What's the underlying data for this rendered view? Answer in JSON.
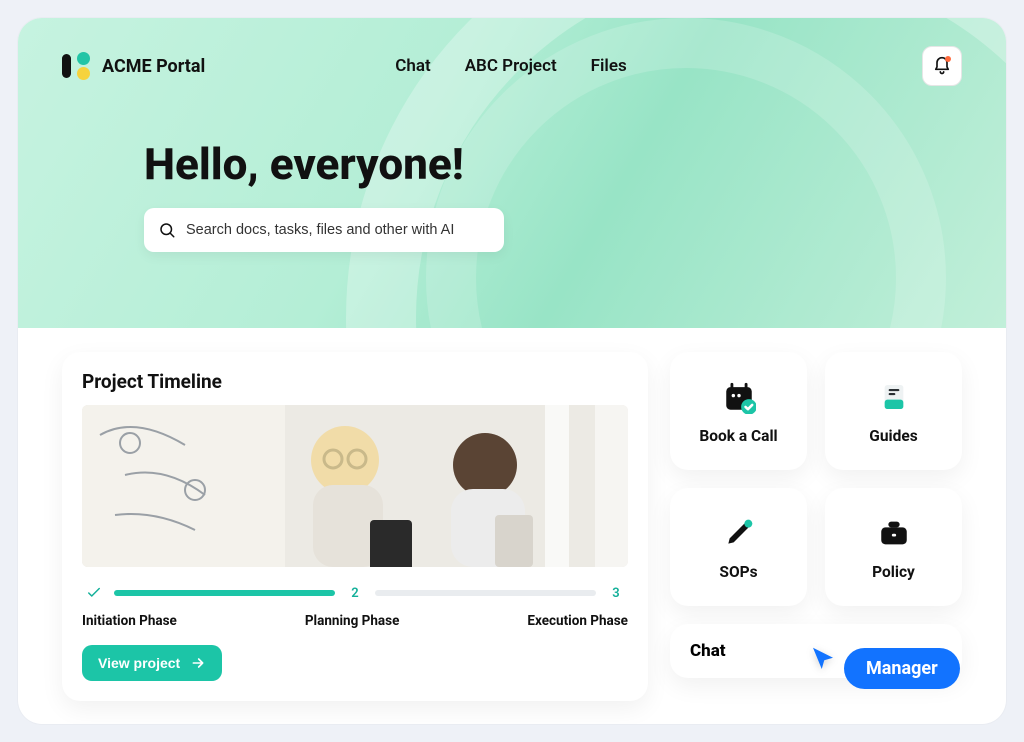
{
  "brand": "ACME Portal",
  "nav": {
    "chat": "Chat",
    "project": "ABC Project",
    "files": "Files"
  },
  "hero": {
    "title": "Hello, everyone!",
    "search_placeholder": "Search docs, tasks, files and other with AI"
  },
  "timeline": {
    "title": "Project Timeline",
    "phases": {
      "p1": "Initiation Phase",
      "p2": "Planning Phase",
      "p3": "Execution Phase",
      "marker2": "2",
      "marker3": "3"
    },
    "button": "View project"
  },
  "cards": {
    "book": "Book a Call",
    "guides": "Guides",
    "sops": "SOPs",
    "policy": "Policy"
  },
  "chat_title": "Chat",
  "presence": {
    "label": "Manager"
  }
}
